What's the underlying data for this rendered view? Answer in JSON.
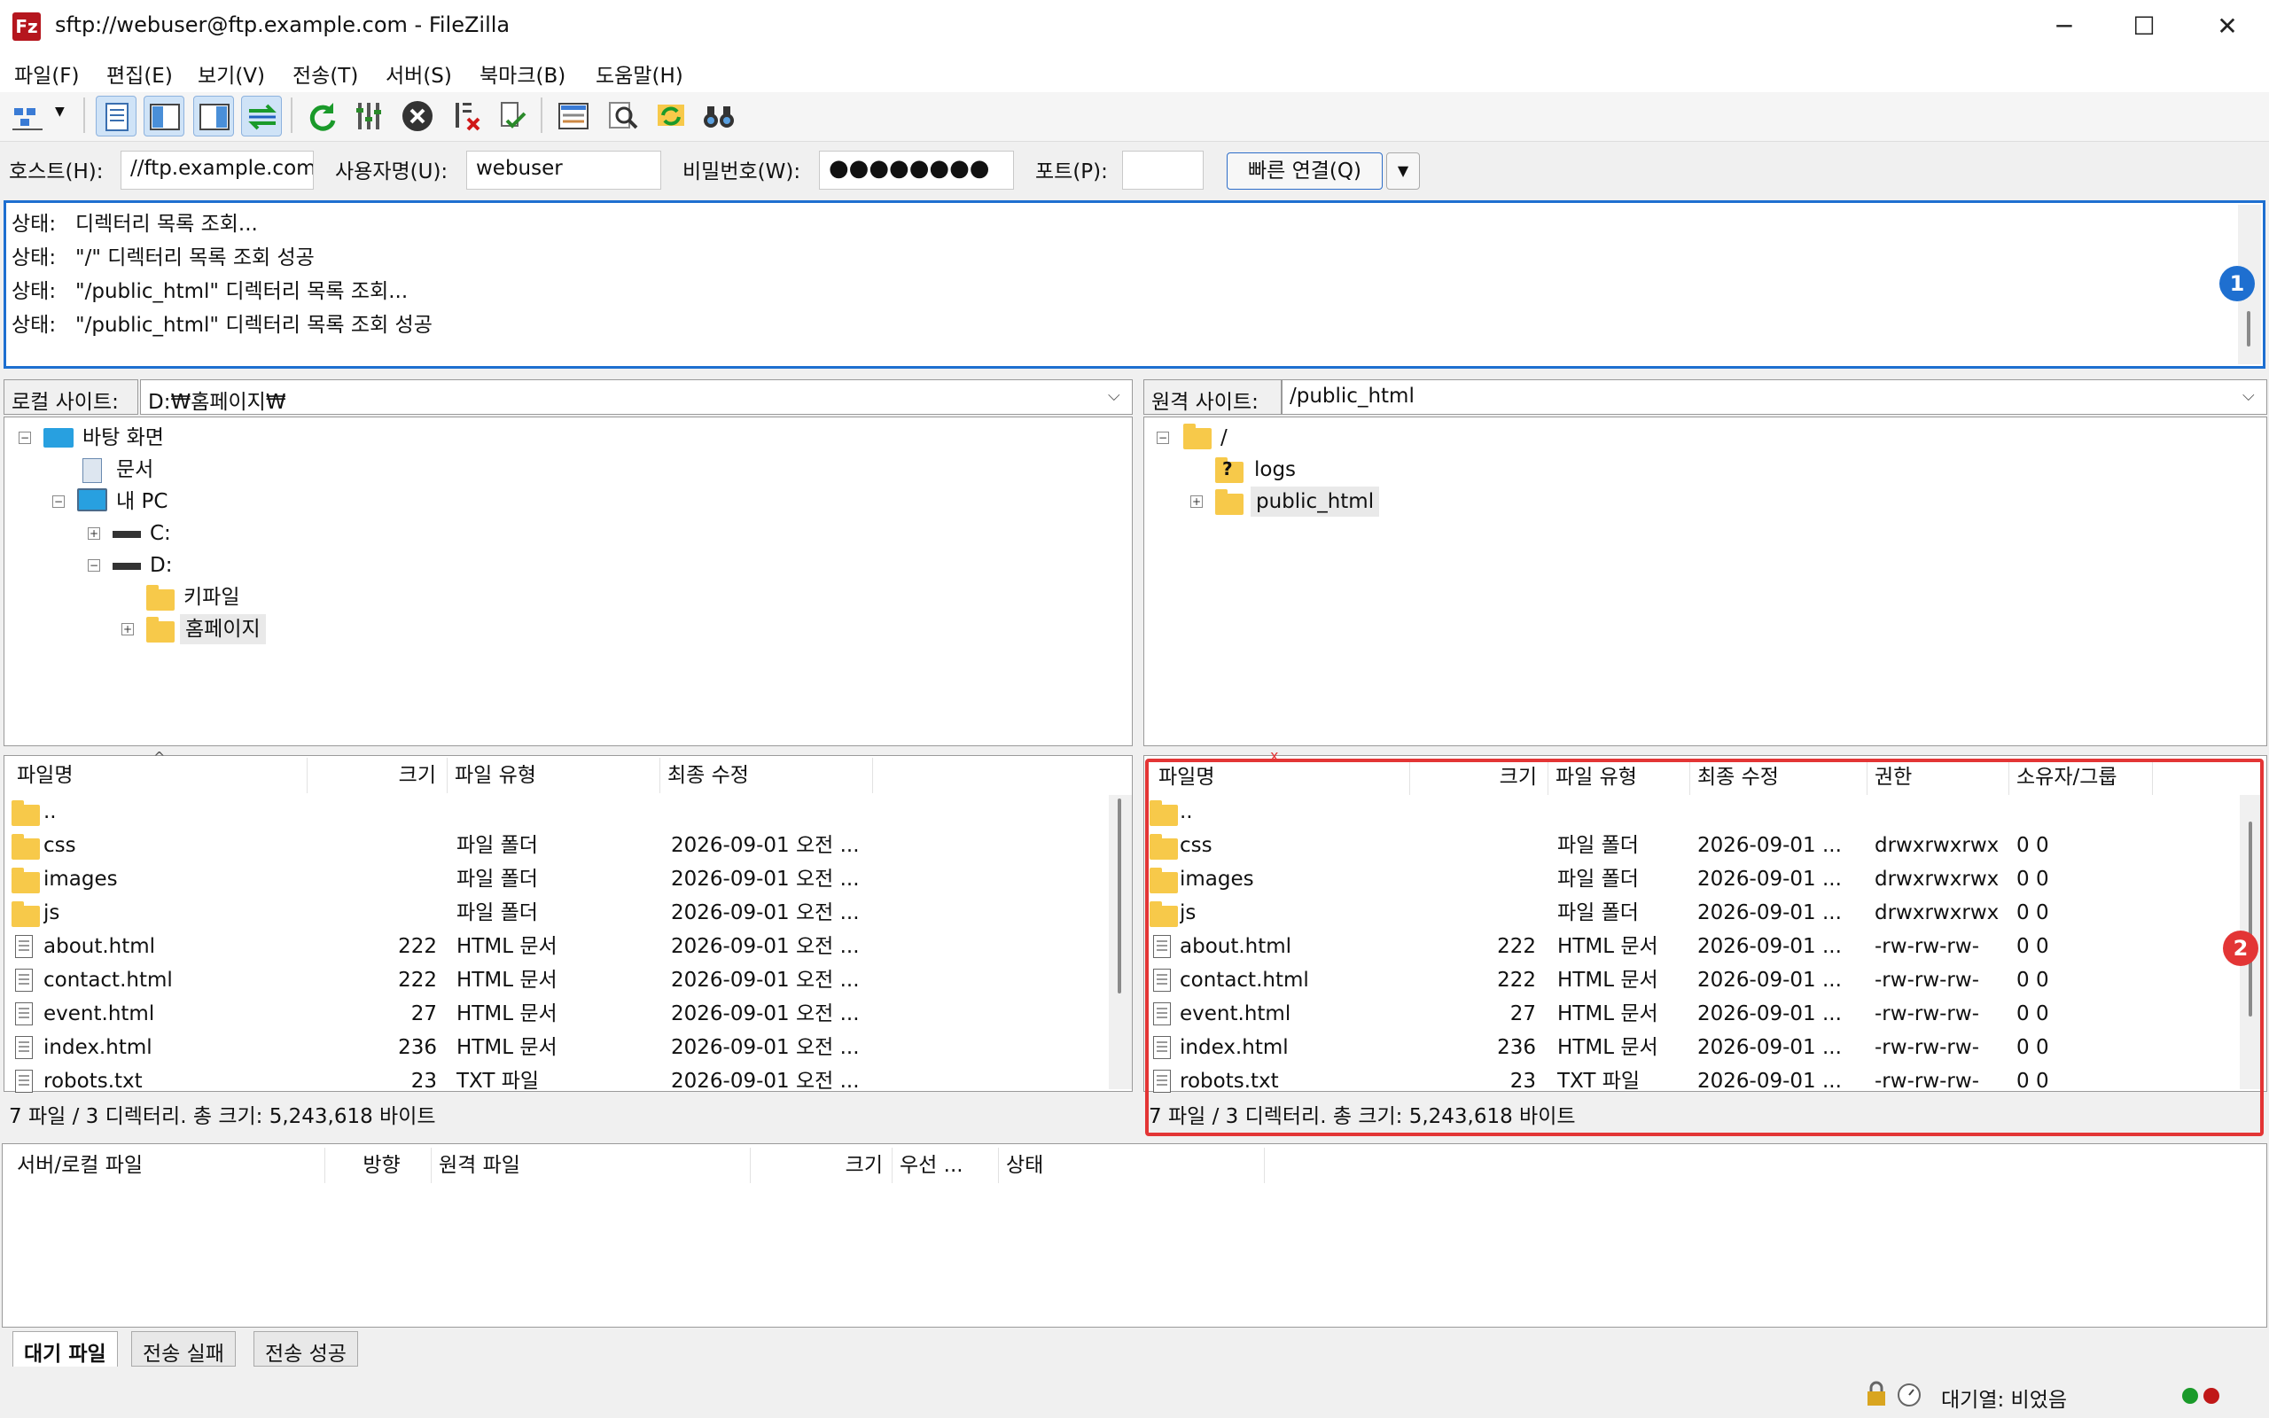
{
  "window": {
    "title": "sftp://webuser@ftp.example.com - FileZilla",
    "app_icon": "Fz",
    "minimize": "─",
    "maximize": "☐",
    "close": "✕"
  },
  "menu": [
    "파일(F)",
    "편집(E)",
    "보기(V)",
    "전송(T)",
    "서버(S)",
    "북마크(B)",
    "도움말(H)"
  ],
  "toolbar": {
    "icons": [
      "site-manager-icon",
      "dropdown-arrow-icon",
      "message-log-icon",
      "local-tree-icon",
      "remote-tree-icon",
      "transfer-queue-icon",
      "refresh-icon",
      "process-queue-icon",
      "cancel-icon",
      "disconnect-icon",
      "reconnect-icon",
      "filter-icon",
      "compare-icon",
      "sync-browse-icon",
      "search-icon"
    ]
  },
  "quickconnect": {
    "host_label": "호스트(H):",
    "host_value": "//ftp.example.com",
    "user_label": "사용자명(U):",
    "user_value": "webuser",
    "pass_label": "비밀번호(W):",
    "pass_value": "●●●●●●●●",
    "port_label": "포트(P):",
    "port_value": "",
    "connect_label": "빠른 연결(Q)",
    "dropdown": "▼"
  },
  "log": {
    "lines": [
      {
        "label": "상태:",
        "text": "디렉터리 목록 조회..."
      },
      {
        "label": "상태:",
        "text": "\"/\" 디렉터리 목록 조회 성공"
      },
      {
        "label": "상태:",
        "text": "\"/public_html\" 디렉터리 목록 조회..."
      },
      {
        "label": "상태:",
        "text": "\"/public_html\" 디렉터리 목록 조회 성공"
      }
    ],
    "badge": "1"
  },
  "local": {
    "site_label": "로컬 사이트:",
    "path": "D:₩홈페이지₩",
    "tree": [
      "바탕 화면",
      "문서",
      "내 PC",
      "C:",
      "D:",
      "키파일",
      "홈페이지"
    ],
    "columns": [
      "파일명",
      "크기",
      "파일 유형",
      "최종 수정"
    ],
    "rows": [
      {
        "name": "..",
        "size": "",
        "type": "",
        "modified": "",
        "icon": "folder"
      },
      {
        "name": "css",
        "size": "",
        "type": "파일 폴더",
        "modified": "2026-09-01 오전 ...",
        "icon": "folder"
      },
      {
        "name": "images",
        "size": "",
        "type": "파일 폴더",
        "modified": "2026-09-01 오전 ...",
        "icon": "folder"
      },
      {
        "name": "js",
        "size": "",
        "type": "파일 폴더",
        "modified": "2026-09-01 오전 ...",
        "icon": "folder"
      },
      {
        "name": "about.html",
        "size": "222",
        "type": "HTML 문서",
        "modified": "2026-09-01 오전 ...",
        "icon": "file"
      },
      {
        "name": "contact.html",
        "size": "222",
        "type": "HTML 문서",
        "modified": "2026-09-01 오전 ...",
        "icon": "file"
      },
      {
        "name": "event.html",
        "size": "27",
        "type": "HTML 문서",
        "modified": "2026-09-01 오전 ...",
        "icon": "file"
      },
      {
        "name": "index.html",
        "size": "236",
        "type": "HTML 문서",
        "modified": "2026-09-01 오전 ...",
        "icon": "file"
      },
      {
        "name": "robots.txt",
        "size": "23",
        "type": "TXT 파일",
        "modified": "2026-09-01 오전 ...",
        "icon": "file"
      }
    ],
    "summary": "7 파일 / 3 디렉터리. 총 크기: 5,243,618 바이트"
  },
  "remote": {
    "site_label": "원격 사이트:",
    "path": "/public_html",
    "tree": [
      "/",
      "logs",
      "public_html"
    ],
    "columns": [
      "파일명",
      "크기",
      "파일 유형",
      "최종 수정",
      "권한",
      "소유자/그룹"
    ],
    "rows": [
      {
        "name": "..",
        "size": "",
        "type": "",
        "modified": "",
        "perm": "",
        "owner": "",
        "icon": "folder"
      },
      {
        "name": "css",
        "size": "",
        "type": "파일 폴더",
        "modified": "2026-09-01 ...",
        "perm": "drwxrwxrwx",
        "owner": "0 0",
        "icon": "folder"
      },
      {
        "name": "images",
        "size": "",
        "type": "파일 폴더",
        "modified": "2026-09-01 ...",
        "perm": "drwxrwxrwx",
        "owner": "0 0",
        "icon": "folder"
      },
      {
        "name": "js",
        "size": "",
        "type": "파일 폴더",
        "modified": "2026-09-01 ...",
        "perm": "drwxrwxrwx",
        "owner": "0 0",
        "icon": "folder"
      },
      {
        "name": "about.html",
        "size": "222",
        "type": "HTML 문서",
        "modified": "2026-09-01 ...",
        "perm": "-rw-rw-rw-",
        "owner": "0 0",
        "icon": "file"
      },
      {
        "name": "contact.html",
        "size": "222",
        "type": "HTML 문서",
        "modified": "2026-09-01 ...",
        "perm": "-rw-rw-rw-",
        "owner": "0 0",
        "icon": "file"
      },
      {
        "name": "event.html",
        "size": "27",
        "type": "HTML 문서",
        "modified": "2026-09-01 ...",
        "perm": "-rw-rw-rw-",
        "owner": "0 0",
        "icon": "file"
      },
      {
        "name": "index.html",
        "size": "236",
        "type": "HTML 문서",
        "modified": "2026-09-01 ...",
        "perm": "-rw-rw-rw-",
        "owner": "0 0",
        "icon": "file"
      },
      {
        "name": "robots.txt",
        "size": "23",
        "type": "TXT 파일",
        "modified": "2026-09-01 ...",
        "perm": "-rw-rw-rw-",
        "owner": "0 0",
        "icon": "file"
      }
    ],
    "summary": "7 파일 / 3 디렉터리. 총 크기: 5,243,618 바이트",
    "badge": "2"
  },
  "queue": {
    "columns": [
      "서버/로컬 파일",
      "방향",
      "원격 파일",
      "크기",
      "우선 ...",
      "상태"
    ],
    "tabs": [
      "대기 파일",
      "전송 실패",
      "전송 성공"
    ]
  },
  "statusbar": {
    "queue_text": "대기열: 비었음"
  },
  "colors": {
    "accent_blue": "#1e6fd0",
    "highlight_red": "#e33535",
    "folder": "#f7c94a",
    "led_green": "#1a9a2a",
    "led_red": "#c01818"
  }
}
